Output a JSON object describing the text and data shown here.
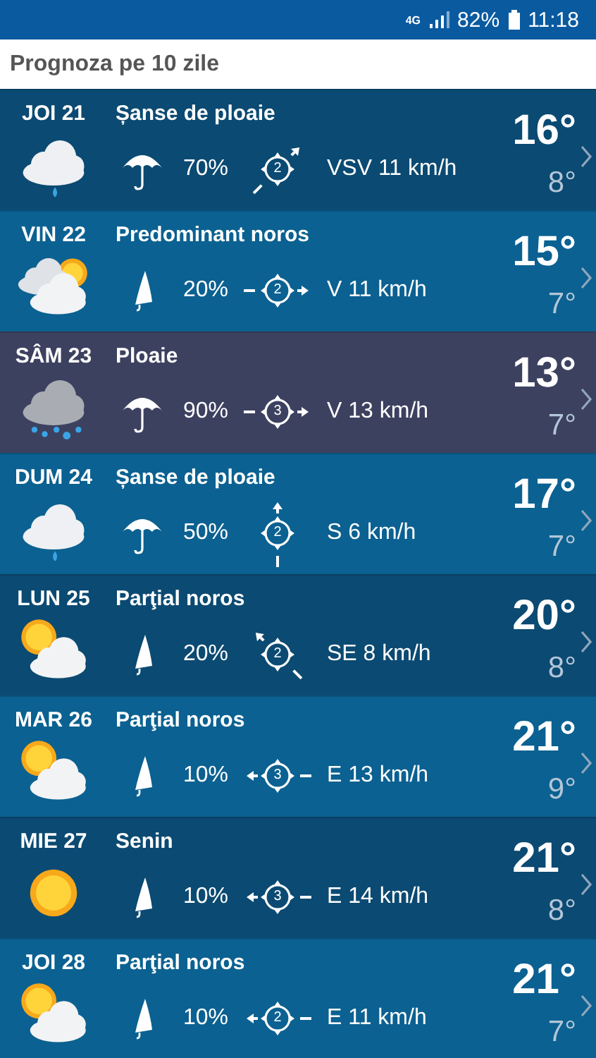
{
  "status_bar": {
    "network": "4G",
    "battery": "82%",
    "time": "11:18"
  },
  "header": {
    "title": "Prognoza pe 10 zile"
  },
  "days": [
    {
      "day": "JOI 21",
      "condition": "Șanse de ploaie",
      "kind": "light-rain",
      "umbrella": {
        "kind": "open"
      },
      "rain": "70%",
      "wind_force": "2",
      "wind_arrow": {
        "kind": "northeast"
      },
      "wind": "VSV 11 km/h",
      "high": "16°",
      "low": "8°"
    },
    {
      "day": "VIN 22",
      "condition": "Predominant noros",
      "kind": "mostly-cloudy",
      "umbrella": {
        "kind": "closed"
      },
      "rain": "20%",
      "wind_force": "2",
      "wind_arrow": {
        "kind": "east"
      },
      "wind": "V 11 km/h",
      "high": "15°",
      "low": "7°"
    },
    {
      "day": "SÂM 23",
      "condition": "Ploaie",
      "kind": "rain",
      "umbrella": {
        "kind": "open"
      },
      "rain": "90%",
      "wind_force": "3",
      "wind_arrow": {
        "kind": "east"
      },
      "wind": "V 13 km/h",
      "high": "13°",
      "low": "7°"
    },
    {
      "day": "DUM 24",
      "condition": "Șanse de ploaie",
      "kind": "light-rain",
      "umbrella": {
        "kind": "open"
      },
      "rain": "50%",
      "wind_force": "2",
      "wind_arrow": {
        "kind": "north"
      },
      "wind": "S 6 km/h",
      "high": "17°",
      "low": "7°"
    },
    {
      "day": "LUN 25",
      "condition": "Parţial noros",
      "kind": "partly-cloudy",
      "umbrella": {
        "kind": "closed"
      },
      "rain": "20%",
      "wind_force": "2",
      "wind_arrow": {
        "kind": "northwest"
      },
      "wind": "SE 8 km/h",
      "high": "20°",
      "low": "8°"
    },
    {
      "day": "MAR 26",
      "condition": "Parţial noros",
      "kind": "partly-cloudy",
      "umbrella": {
        "kind": "closed"
      },
      "rain": "10%",
      "wind_force": "3",
      "wind_arrow": {
        "kind": "west"
      },
      "wind": "E 13 km/h",
      "high": "21°",
      "low": "9°"
    },
    {
      "day": "MIE 27",
      "condition": "Senin",
      "kind": "sunny",
      "umbrella": {
        "kind": "closed"
      },
      "rain": "10%",
      "wind_force": "3",
      "wind_arrow": {
        "kind": "west"
      },
      "wind": "E 14 km/h",
      "high": "21°",
      "low": "8°"
    },
    {
      "day": "JOI 28",
      "condition": "Parţial noros",
      "kind": "partly-cloudy",
      "umbrella": {
        "kind": "closed"
      },
      "rain": "10%",
      "wind_force": "2",
      "wind_arrow": {
        "kind": "west"
      },
      "wind": "E 11 km/h",
      "high": "21°",
      "low": "7°"
    }
  ]
}
